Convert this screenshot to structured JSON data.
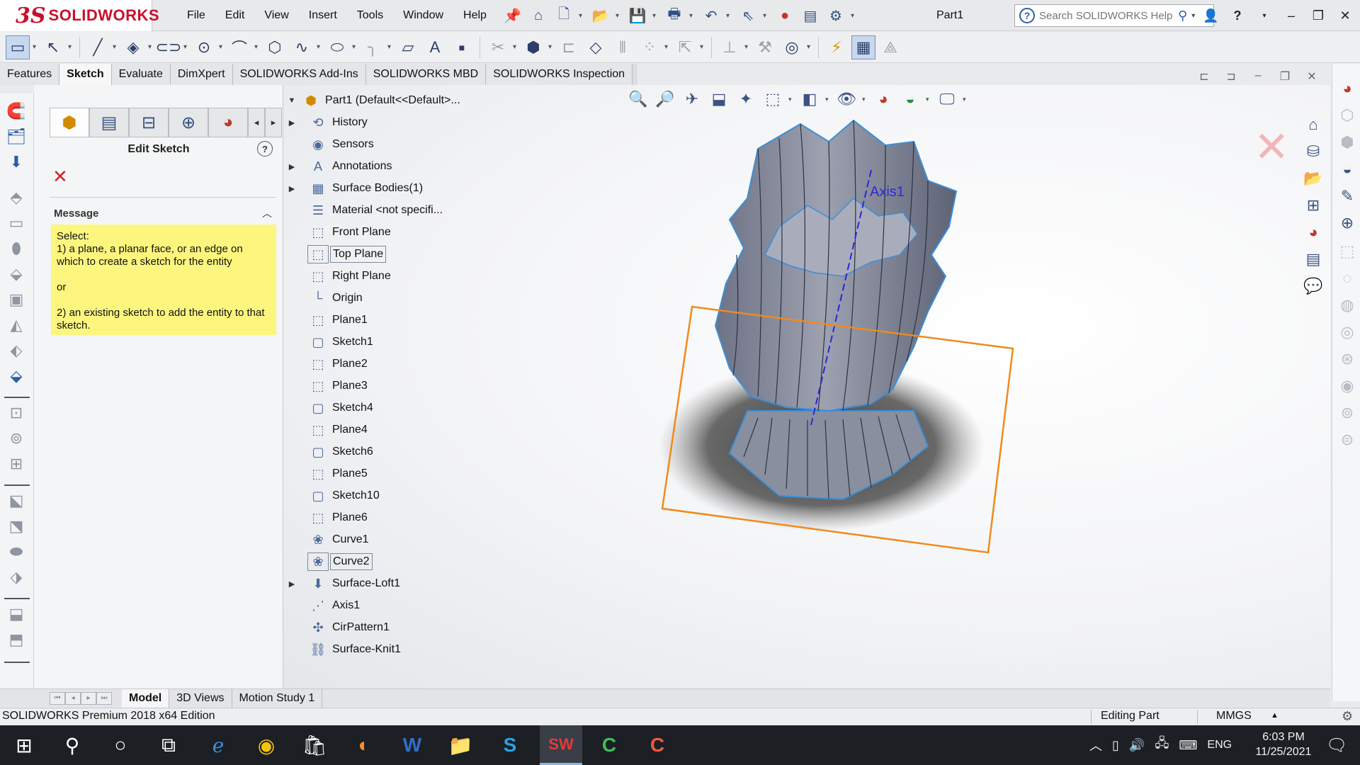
{
  "app": {
    "brand": "SOLIDWORKS",
    "doc_title": "Part1",
    "help_search_placeholder": "Search SOLIDWORKS Help"
  },
  "menu": [
    "File",
    "Edit",
    "View",
    "Insert",
    "Tools",
    "Window",
    "Help"
  ],
  "command_tabs": [
    {
      "label": "Features",
      "active": false
    },
    {
      "label": "Sketch",
      "active": true
    },
    {
      "label": "Evaluate",
      "active": false
    },
    {
      "label": "DimXpert",
      "active": false
    },
    {
      "label": "SOLIDWORKS Add-Ins",
      "active": false
    },
    {
      "label": "SOLIDWORKS MBD",
      "active": false
    },
    {
      "label": "SOLIDWORKS Inspection",
      "active": false
    }
  ],
  "property_manager": {
    "title": "Edit Sketch",
    "message_header": "Message",
    "message_text": "Select:\n1) a plane, a planar face, or an edge on which to create a sketch for the entity\n\nor\n\n2) an existing sketch to add the entity to that sketch."
  },
  "feature_tree": {
    "root": "Part1  (Default<<Default>...",
    "items": [
      {
        "label": "History",
        "icon": "history-icon",
        "expandable": true
      },
      {
        "label": "Sensors",
        "icon": "sensors-icon",
        "expandable": false
      },
      {
        "label": "Annotations",
        "icon": "annotations-icon",
        "expandable": true
      },
      {
        "label": "Surface Bodies(1)",
        "icon": "surface-bodies-icon",
        "expandable": true
      },
      {
        "label": "Material <not specifi...",
        "icon": "material-icon",
        "expandable": false
      },
      {
        "label": "Front Plane",
        "icon": "plane-icon",
        "expandable": false
      },
      {
        "label": "Top Plane",
        "icon": "plane-icon",
        "expandable": false,
        "selected": true
      },
      {
        "label": "Right Plane",
        "icon": "plane-icon",
        "expandable": false
      },
      {
        "label": "Origin",
        "icon": "origin-icon",
        "expandable": false
      },
      {
        "label": "Plane1",
        "icon": "plane-icon",
        "expandable": false
      },
      {
        "label": "Sketch1",
        "icon": "sketch-icon",
        "expandable": false
      },
      {
        "label": "Plane2",
        "icon": "plane-icon",
        "expandable": false
      },
      {
        "label": "Plane3",
        "icon": "plane-icon",
        "expandable": false
      },
      {
        "label": "Sketch4",
        "icon": "sketch-icon",
        "expandable": false
      },
      {
        "label": "Plane4",
        "icon": "plane-icon",
        "expandable": false
      },
      {
        "label": "Sketch6",
        "icon": "sketch-icon",
        "expandable": false
      },
      {
        "label": "Plane5",
        "icon": "plane-icon",
        "expandable": false
      },
      {
        "label": "Sketch10",
        "icon": "sketch-icon",
        "expandable": false
      },
      {
        "label": "Plane6",
        "icon": "plane-icon",
        "expandable": false
      },
      {
        "label": "Curve1",
        "icon": "curve-icon",
        "expandable": false
      },
      {
        "label": "Curve2",
        "icon": "curve-icon",
        "expandable": false,
        "selected": true
      },
      {
        "label": "Surface-Loft1",
        "icon": "loft-icon",
        "expandable": true
      },
      {
        "label": "Axis1",
        "icon": "axis-icon",
        "expandable": false
      },
      {
        "label": "CirPattern1",
        "icon": "pattern-icon",
        "expandable": false
      },
      {
        "label": "Surface-Knit1",
        "icon": "knit-icon",
        "expandable": false
      }
    ]
  },
  "graphics": {
    "axis_label": "Axis1",
    "plane_color": "#f08a1c",
    "model_color": "#7c8092",
    "edge_color": "#3a8fd8"
  },
  "model_tabs": [
    {
      "label": "Model",
      "active": true
    },
    {
      "label": "3D Views",
      "active": false
    },
    {
      "label": "Motion Study 1",
      "active": false
    }
  ],
  "status": {
    "edition": "SOLIDWORKS Premium 2018 x64 Edition",
    "mode": "Editing Part",
    "units": "MMGS"
  },
  "taskbar": {
    "lang": "ENG",
    "time": "6:03 PM",
    "date": "11/25/2021"
  }
}
